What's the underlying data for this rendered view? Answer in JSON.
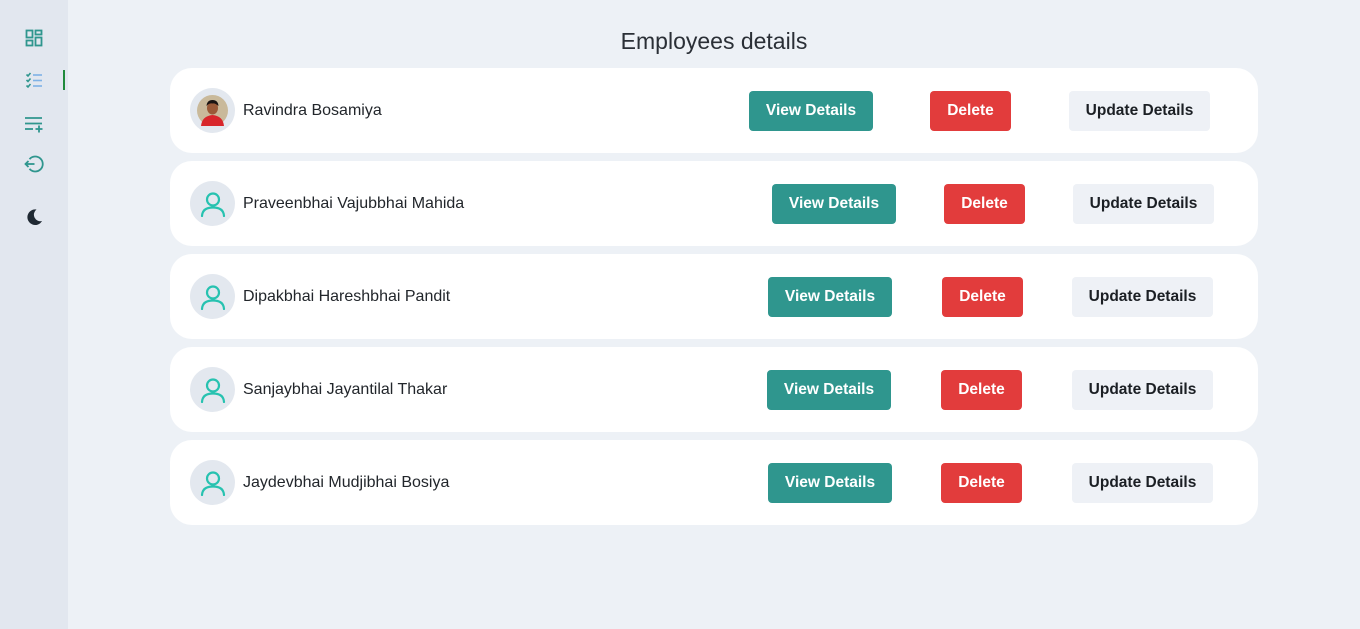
{
  "sidebar": {
    "items": [
      {
        "name": "dashboard-icon"
      },
      {
        "name": "checklist-icon",
        "active": true
      },
      {
        "name": "add-list-icon"
      },
      {
        "name": "logout-icon"
      },
      {
        "name": "moon-icon"
      }
    ]
  },
  "page": {
    "title": "Employees details"
  },
  "employees": [
    {
      "name": "Ravindra Bosamiya",
      "avatar": "photo"
    },
    {
      "name": "Praveenbhai Vajubbhai Mahida",
      "avatar": "user-icon"
    },
    {
      "name": "Dipakbhai Hareshbhai Pandit",
      "avatar": "user-icon"
    },
    {
      "name": "Sanjaybhai Jayantilal Thakar",
      "avatar": "user-icon"
    },
    {
      "name": "Jaydevbhai Mudjibhai Bosiya",
      "avatar": "user-icon"
    }
  ],
  "actions": {
    "view_label": "View Details",
    "delete_label": "Delete",
    "update_label": "Update Details"
  },
  "colors": {
    "accent": "#2f968e",
    "danger": "#e23c3c",
    "neutral_button": "#eef1f6",
    "background": "#edf1f6",
    "sidebar": "#e2e7ef",
    "active_indicator": "#1f8a3b"
  }
}
